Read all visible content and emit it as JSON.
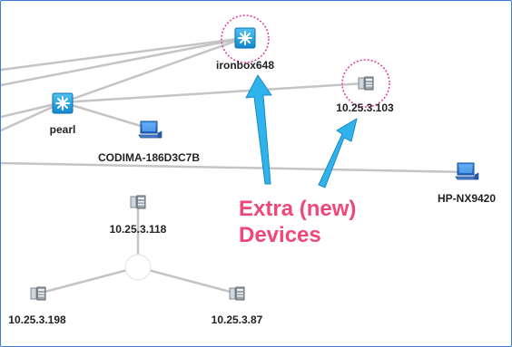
{
  "colors": {
    "frame": "#3a7bd5",
    "link": "#c4c4c4",
    "arrow": "#2fb3ec",
    "arrow_stroke": "#1a88c4",
    "callout_text": "#f0477a",
    "highlight_ring": "#e0389a",
    "switch_icon_bg": "#22a0dc"
  },
  "nodes": {
    "ironbox": {
      "label": "ironbox648",
      "icon": "switch-icon"
    },
    "pearl": {
      "label": "pearl",
      "icon": "switch-icon"
    },
    "ip103": {
      "label": "10.25.3.103",
      "icon": "server-icon"
    },
    "codima": {
      "label": "CODIMA-186D3C7B",
      "icon": "computer-icon"
    },
    "hpnx": {
      "label": "HP-NX9420",
      "icon": "computer-icon"
    },
    "ip118": {
      "label": "10.25.3.118",
      "icon": "server-icon"
    },
    "ip198": {
      "label": "10.25.3.198",
      "icon": "server-icon"
    },
    "ip87": {
      "label": "10.25.3.87",
      "icon": "server-icon"
    }
  },
  "callout": {
    "line1": "Extra (new)",
    "line2": "Devices"
  }
}
